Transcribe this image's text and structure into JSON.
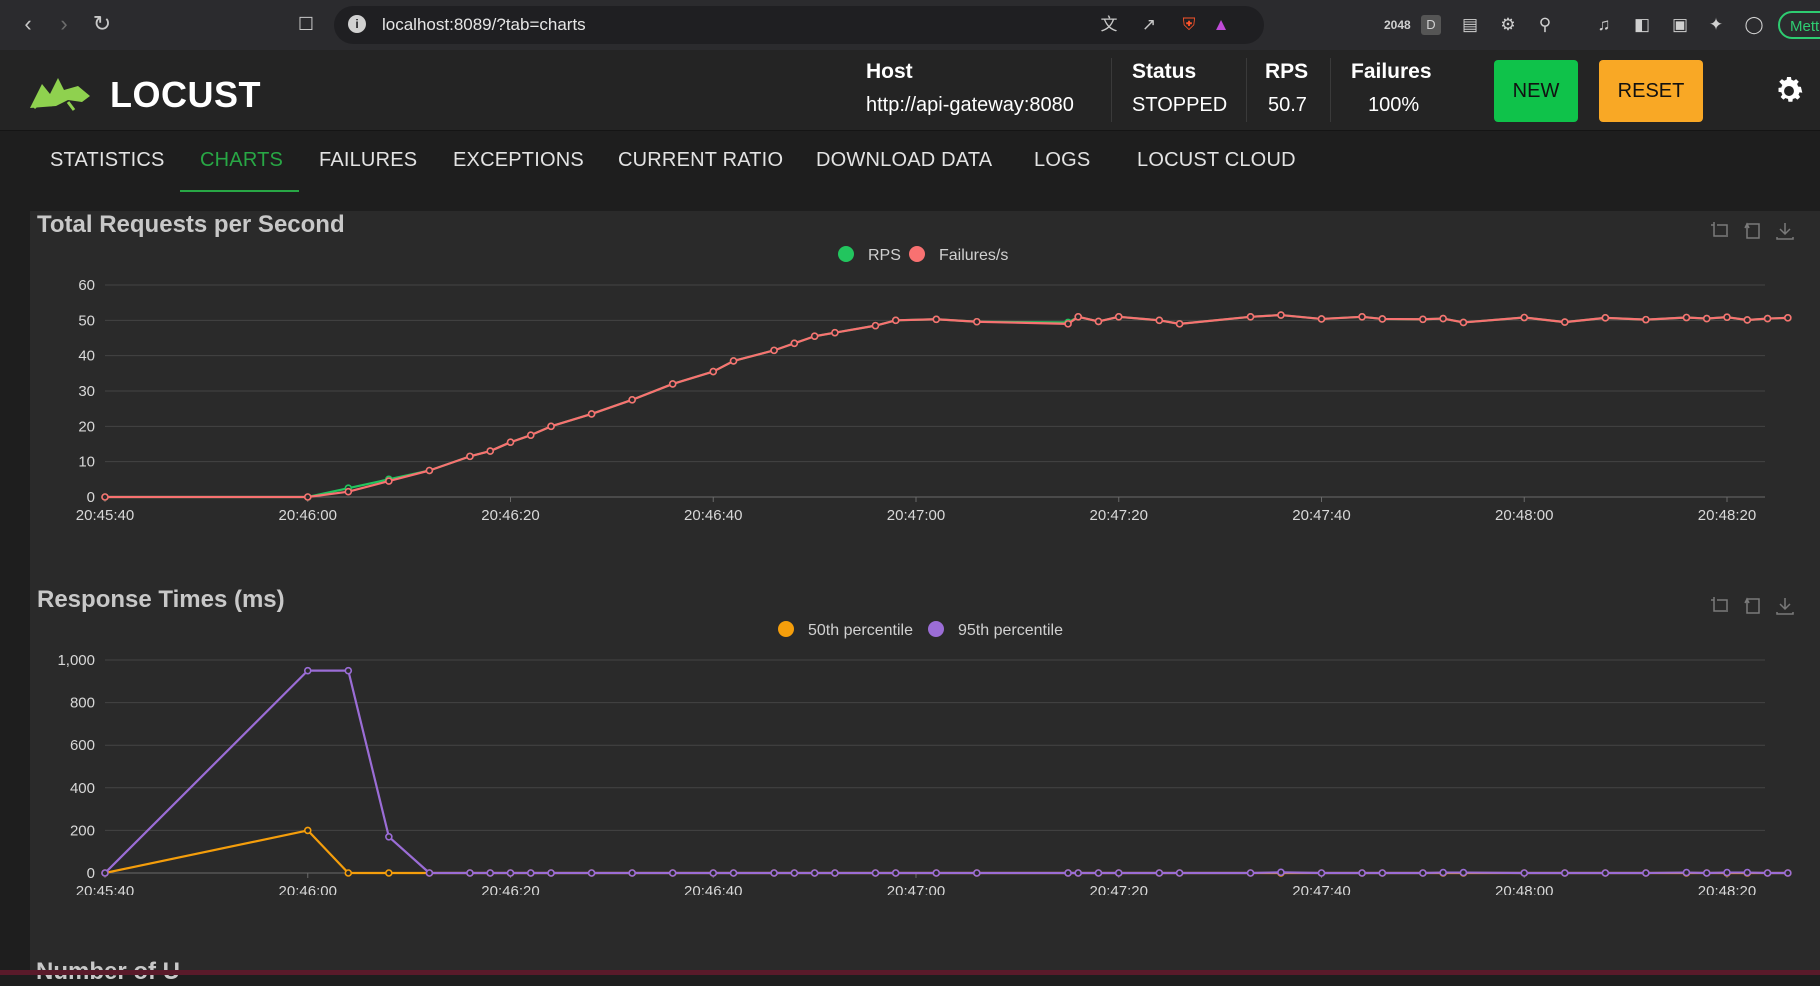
{
  "browser": {
    "url": "localhost:8089/?tab=charts",
    "profile_label": "Mett"
  },
  "app": {
    "logo_text": "LOCUST",
    "colors": {
      "accent_green": "#0fc24a",
      "accent_orange": "#f9a825",
      "tab_active": "#28a745"
    }
  },
  "header": {
    "host_label": "Host",
    "host_value": "http://api-gateway:8080",
    "status_label": "Status",
    "status_value": "STOPPED",
    "rps_label": "RPS",
    "rps_value": "50.7",
    "failures_label": "Failures",
    "failures_value": "100%",
    "new_label": "NEW",
    "reset_label": "RESET"
  },
  "tabs": [
    {
      "label": "STATISTICS"
    },
    {
      "label": "CHARTS"
    },
    {
      "label": "FAILURES"
    },
    {
      "label": "EXCEPTIONS"
    },
    {
      "label": "CURRENT RATIO"
    },
    {
      "label": "DOWNLOAD DATA"
    },
    {
      "label": "LOGS"
    },
    {
      "label": "LOCUST CLOUD"
    }
  ],
  "active_tab": "CHARTS",
  "next_chart_title_partial": "Number of U",
  "chart_data": [
    {
      "type": "line",
      "title": "Total Requests per Second",
      "x_ticks": [
        "20:45:40",
        "20:46:00",
        "20:46:20",
        "20:46:40",
        "20:47:00",
        "20:47:20",
        "20:47:40",
        "20:48:00",
        "20:48:20"
      ],
      "y_ticks": [
        "0",
        "10",
        "20",
        "30",
        "40",
        "50",
        "60"
      ],
      "ylim": [
        0,
        60
      ],
      "x": [
        "20:45:40",
        "20:46:00",
        "20:46:04",
        "20:46:08",
        "20:46:12",
        "20:46:16",
        "20:46:18",
        "20:46:20",
        "20:46:22",
        "20:46:24",
        "20:46:28",
        "20:46:32",
        "20:46:36",
        "20:46:40",
        "20:46:42",
        "20:46:46",
        "20:46:48",
        "20:46:50",
        "20:46:52",
        "20:46:56",
        "20:46:58",
        "20:47:02",
        "20:47:06",
        "20:47:15",
        "20:47:16",
        "20:47:18",
        "20:47:20",
        "20:47:24",
        "20:47:26",
        "20:47:33",
        "20:47:36",
        "20:47:40",
        "20:47:44",
        "20:47:46",
        "20:47:50",
        "20:47:52",
        "20:47:54",
        "20:48:00",
        "20:48:04",
        "20:48:08",
        "20:48:12",
        "20:48:16",
        "20:48:18",
        "20:48:20",
        "20:48:22",
        "20:48:24",
        "20:48:26"
      ],
      "series": [
        {
          "name": "RPS",
          "color": "#22c55e",
          "values": [
            0,
            0,
            2.5,
            5,
            7.5,
            11.5,
            13,
            15.5,
            17.5,
            20,
            23.5,
            27.5,
            32,
            35.5,
            38.5,
            41.5,
            43.5,
            45.5,
            46.5,
            48.5,
            50,
            50.3,
            49.6,
            49.4,
            51,
            49.7,
            51,
            50,
            49,
            51,
            51.5,
            50.4,
            51,
            50.4,
            50.3,
            50.5,
            49.4,
            50.8,
            49.5,
            50.7,
            50.2,
            50.8,
            50.5,
            50.9,
            50.1,
            50.5,
            50.7
          ]
        },
        {
          "name": "Failures/s",
          "color": "#f87171",
          "values": [
            0,
            0,
            1.5,
            4.5,
            7.5,
            11.5,
            13,
            15.5,
            17.5,
            20,
            23.5,
            27.5,
            32,
            35.5,
            38.5,
            41.5,
            43.5,
            45.5,
            46.5,
            48.5,
            50,
            50.3,
            49.6,
            49,
            51,
            49.7,
            51,
            50,
            49,
            51,
            51.5,
            50.4,
            51,
            50.4,
            50.3,
            50.5,
            49.4,
            50.8,
            49.5,
            50.7,
            50.2,
            50.8,
            50.5,
            50.9,
            50.1,
            50.5,
            50.7
          ]
        }
      ],
      "legend": "top-center",
      "grid": true
    },
    {
      "type": "line",
      "title": "Response Times (ms)",
      "x_ticks": [
        "20:45:40",
        "20:46:00",
        "20:46:20",
        "20:46:40",
        "20:47:00",
        "20:47:20",
        "20:47:40",
        "20:48:00",
        "20:48:20"
      ],
      "y_ticks": [
        "0",
        "200",
        "400",
        "600",
        "800",
        "1,000"
      ],
      "ylim": [
        0,
        1000
      ],
      "x": [
        "20:45:40",
        "20:46:00",
        "20:46:04",
        "20:46:08",
        "20:46:12",
        "20:46:16",
        "20:46:18",
        "20:46:20",
        "20:46:22",
        "20:46:24",
        "20:46:28",
        "20:46:32",
        "20:46:36",
        "20:46:40",
        "20:46:42",
        "20:46:46",
        "20:46:48",
        "20:46:50",
        "20:46:52",
        "20:46:56",
        "20:46:58",
        "20:47:02",
        "20:47:06",
        "20:47:15",
        "20:47:16",
        "20:47:18",
        "20:47:20",
        "20:47:24",
        "20:47:26",
        "20:47:33",
        "20:47:36",
        "20:47:40",
        "20:47:44",
        "20:47:46",
        "20:47:50",
        "20:47:52",
        "20:47:54",
        "20:48:00",
        "20:48:04",
        "20:48:08",
        "20:48:12",
        "20:48:16",
        "20:48:18",
        "20:48:20",
        "20:48:22",
        "20:48:24",
        "20:48:26"
      ],
      "series": [
        {
          "name": "50th percentile",
          "color": "#f59e0b",
          "values": [
            0,
            200,
            0,
            0,
            0,
            0,
            0,
            0,
            0,
            0,
            0,
            0,
            0,
            0,
            0,
            0,
            0,
            0,
            0,
            0,
            0,
            0,
            0,
            0,
            0,
            0,
            0,
            0,
            0,
            0,
            0,
            0,
            0,
            0,
            0,
            0,
            0,
            0,
            0,
            0,
            0,
            0,
            0,
            0,
            0,
            0,
            0
          ]
        },
        {
          "name": "95th percentile",
          "color": "#9b6dd6",
          "values": [
            0,
            950,
            950,
            170,
            0,
            0,
            0,
            0,
            0,
            0,
            0,
            0,
            0,
            0,
            0,
            0,
            0,
            0,
            0,
            0,
            0,
            0,
            0,
            0,
            0,
            0,
            0,
            0,
            0,
            0,
            3,
            0,
            0,
            0,
            0,
            2,
            2,
            0,
            0,
            0,
            0,
            2,
            0,
            2,
            2,
            0,
            0
          ]
        }
      ],
      "legend": "top-center",
      "grid": true
    }
  ]
}
